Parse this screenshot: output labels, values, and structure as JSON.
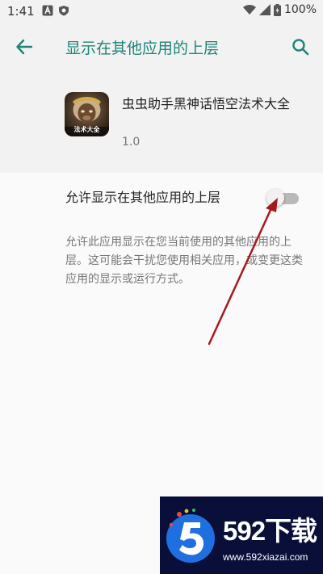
{
  "status_bar": {
    "time": "1:41",
    "battery": "100%"
  },
  "app_bar": {
    "title": "显示在其他应用的上层"
  },
  "app": {
    "name": "虫虫助手黑神话悟空法术大全",
    "version": "1.0",
    "icon_label": "法术大全"
  },
  "permission": {
    "label": "允许显示在其他应用的上层",
    "enabled": false,
    "description": "允许此应用显示在您当前使用的其他应用的上层。这可能会干扰您使用相关应用，或变更这类应用的显示或运行方式。"
  },
  "watermark": {
    "brand": "592下载",
    "url": "www.592xiazai.com"
  },
  "colors": {
    "accent": "#1e847a",
    "annotation_arrow": "#a51a1f"
  }
}
